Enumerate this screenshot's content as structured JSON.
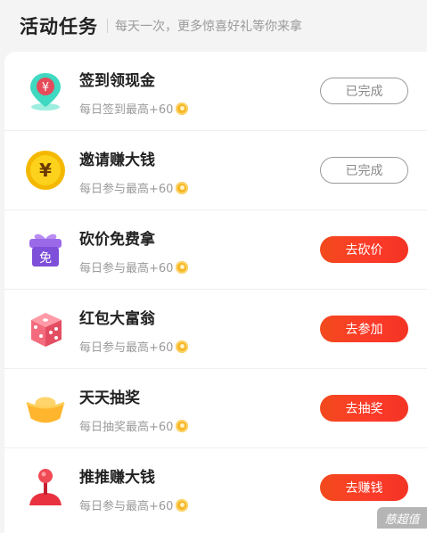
{
  "header": {
    "title": "活动任务",
    "subtitle": "每天一次，更多惊喜好礼等你来拿"
  },
  "tasks": [
    {
      "name": "签到领现金",
      "reward": "每日签到最高+60",
      "button": "已完成",
      "status": "done",
      "icon": "map-pin-yuan-icon"
    },
    {
      "name": "邀请赚大钱",
      "reward": "每日参与最高+60",
      "button": "已完成",
      "status": "done",
      "icon": "yuan-coin-icon"
    },
    {
      "name": "砍价免费拿",
      "reward": "每日参与最高+60",
      "button": "去砍价",
      "status": "todo",
      "icon": "gift-box-icon"
    },
    {
      "name": "红包大富翁",
      "reward": "每日参与最高+60",
      "button": "去参加",
      "status": "todo",
      "icon": "dice-icon"
    },
    {
      "name": "天天抽奖",
      "reward": "每日抽奖最高+60",
      "button": "去抽奖",
      "status": "todo",
      "icon": "gold-ingot-icon"
    },
    {
      "name": "推推赚大钱",
      "reward": "每日参与最高+60",
      "button": "去赚钱",
      "status": "todo",
      "icon": "joystick-icon"
    }
  ],
  "colors": {
    "accent": "#f33423",
    "coin": "#f6b624",
    "done_border": "#9a9a9a"
  },
  "watermark": "慈超值"
}
